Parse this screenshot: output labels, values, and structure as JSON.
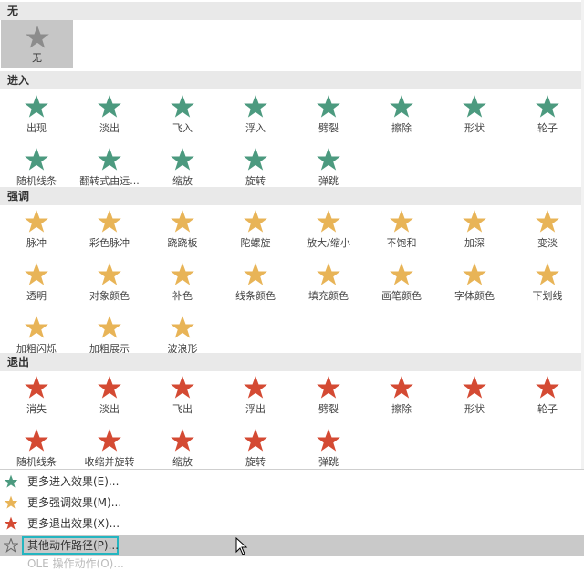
{
  "sections": {
    "none": {
      "title": "无",
      "item": "无"
    },
    "entrance": {
      "title": "进入",
      "items": [
        "出现",
        "淡出",
        "飞入",
        "浮入",
        "劈裂",
        "擦除",
        "形状",
        "轮子",
        "随机线条",
        "翻转式由远...",
        "缩放",
        "旋转",
        "弹跳"
      ]
    },
    "emphasis": {
      "title": "强调",
      "items": [
        "脉冲",
        "彩色脉冲",
        "跷跷板",
        "陀螺旋",
        "放大/缩小",
        "不饱和",
        "加深",
        "变淡",
        "透明",
        "对象颜色",
        "补色",
        "线条颜色",
        "填充颜色",
        "画笔颜色",
        "字体颜色",
        "下划线",
        "加粗闪烁",
        "加粗展示",
        "波浪形"
      ]
    },
    "exit": {
      "title": "退出",
      "items": [
        "消失",
        "淡出",
        "飞出",
        "浮出",
        "劈裂",
        "擦除",
        "形状",
        "轮子",
        "随机线条",
        "收缩并旋转",
        "缩放",
        "旋转",
        "弹跳"
      ]
    }
  },
  "menu": {
    "more_entrance": "更多进入效果(E)...",
    "more_emphasis": "更多强调效果(M)...",
    "more_exit": "更多退出效果(X)...",
    "motion_paths": "其他动作路径(P)...",
    "ole": "OLE 操作动作(O)..."
  },
  "colors": {
    "entrance": "#4c9a7f",
    "emphasis": "#e8b457",
    "exit": "#d44a33",
    "none": "#8c8c8c"
  }
}
